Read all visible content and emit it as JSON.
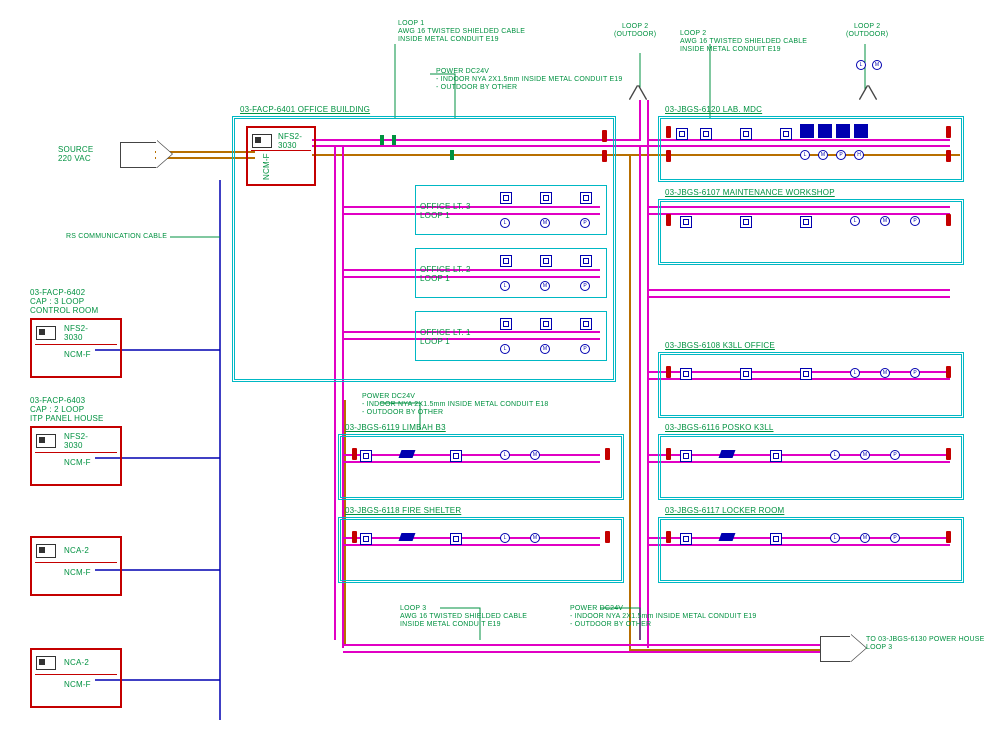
{
  "source": {
    "label": "SOURCE\n220 VAC"
  },
  "loop_notes": {
    "loop1": "LOOP 1\nAWG 16 TWISTED SHIELDED CABLE\nINSIDE METAL CONDUIT E19",
    "loop2_out_left": "LOOP 2\n(OUTDOOR)",
    "loop2_out_right": "LOOP 2\n(OUTDOOR)",
    "loop2_cable": "LOOP 2\nAWG 16 TWISTED SHIELDED CABLE\nINSIDE METAL CONDUIT E19",
    "power_dc24v_top": "POWER DC24V\n- INDOOR NYA 2X1.5mm INSIDE METAL CONDUIT E19\n- OUTDOOR BY OTHER",
    "power_dc24v_mid": "POWER DC24V\n- INDOOR NYA 2X1.5mm INSIDE METAL CONDUIT E18\n- OUTDOOR BY OTHER",
    "loop3": "LOOP 3\nAWG 16 TWISTED SHIELDED CABLE\nINSIDE METAL CONDUIT E19",
    "power_dc24v_bot": "POWER DC24V\n- INDOOR NYA 2X1.5mm INSIDE METAL CONDUIT E19\n- OUTDOOR BY OTHER",
    "comm_cable": "RS COMMUNICATION CABLE"
  },
  "main_panel": {
    "tag": "03-FACP-6401 OFFICE BUILDING",
    "model": "NFS2-\n3030",
    "net": "NCM-F"
  },
  "offices": {
    "lt3": "OFFICE LT. 3\nLOOP 1",
    "lt2": "OFFICE LT. 2\nLOOP 1",
    "lt1": "OFFICE LT. 1\nLOOP 1"
  },
  "right_panels": [
    {
      "tag": "03-JBGS-6120 LAB. MDC"
    },
    {
      "tag": "03-JBGS-6107 MAINTENANCE WORKSHOP"
    },
    {
      "tag": "03-JBGS-6108 K3LL OFFICE"
    },
    {
      "tag": "03-JBGS-6116 POSKO K3LL"
    },
    {
      "tag": "03-JBGS-6117 LOCKER ROOM"
    }
  ],
  "left_bottom_panels": [
    {
      "tag": "03-JBGS-6119 LIMBAH B3"
    },
    {
      "tag": "03-JBGS-6118 FIRE SHELTER"
    }
  ],
  "side_panels": [
    {
      "title": "03-FACP-6402\nCAP : 3 LOOP\nCONTROL ROOM",
      "model": "NFS2-\n3030",
      "net": "NCM-F"
    },
    {
      "title": "03-FACP-6403\nCAP : 2 LOOP\nITP PANEL HOUSE",
      "model": "NFS2-\n3030",
      "net": "NCM-F"
    },
    {
      "title": "",
      "model": "NCA-2",
      "net": "NCM-F"
    },
    {
      "title": "",
      "model": "NCA-2",
      "net": "NCM-F"
    }
  ],
  "arrow_right": "TO 03-JBGS-6130 POWER HOUSE\nLOOP 3",
  "dev_letters": {
    "l": "L",
    "m": "M",
    "p": "P",
    "h": "H"
  }
}
